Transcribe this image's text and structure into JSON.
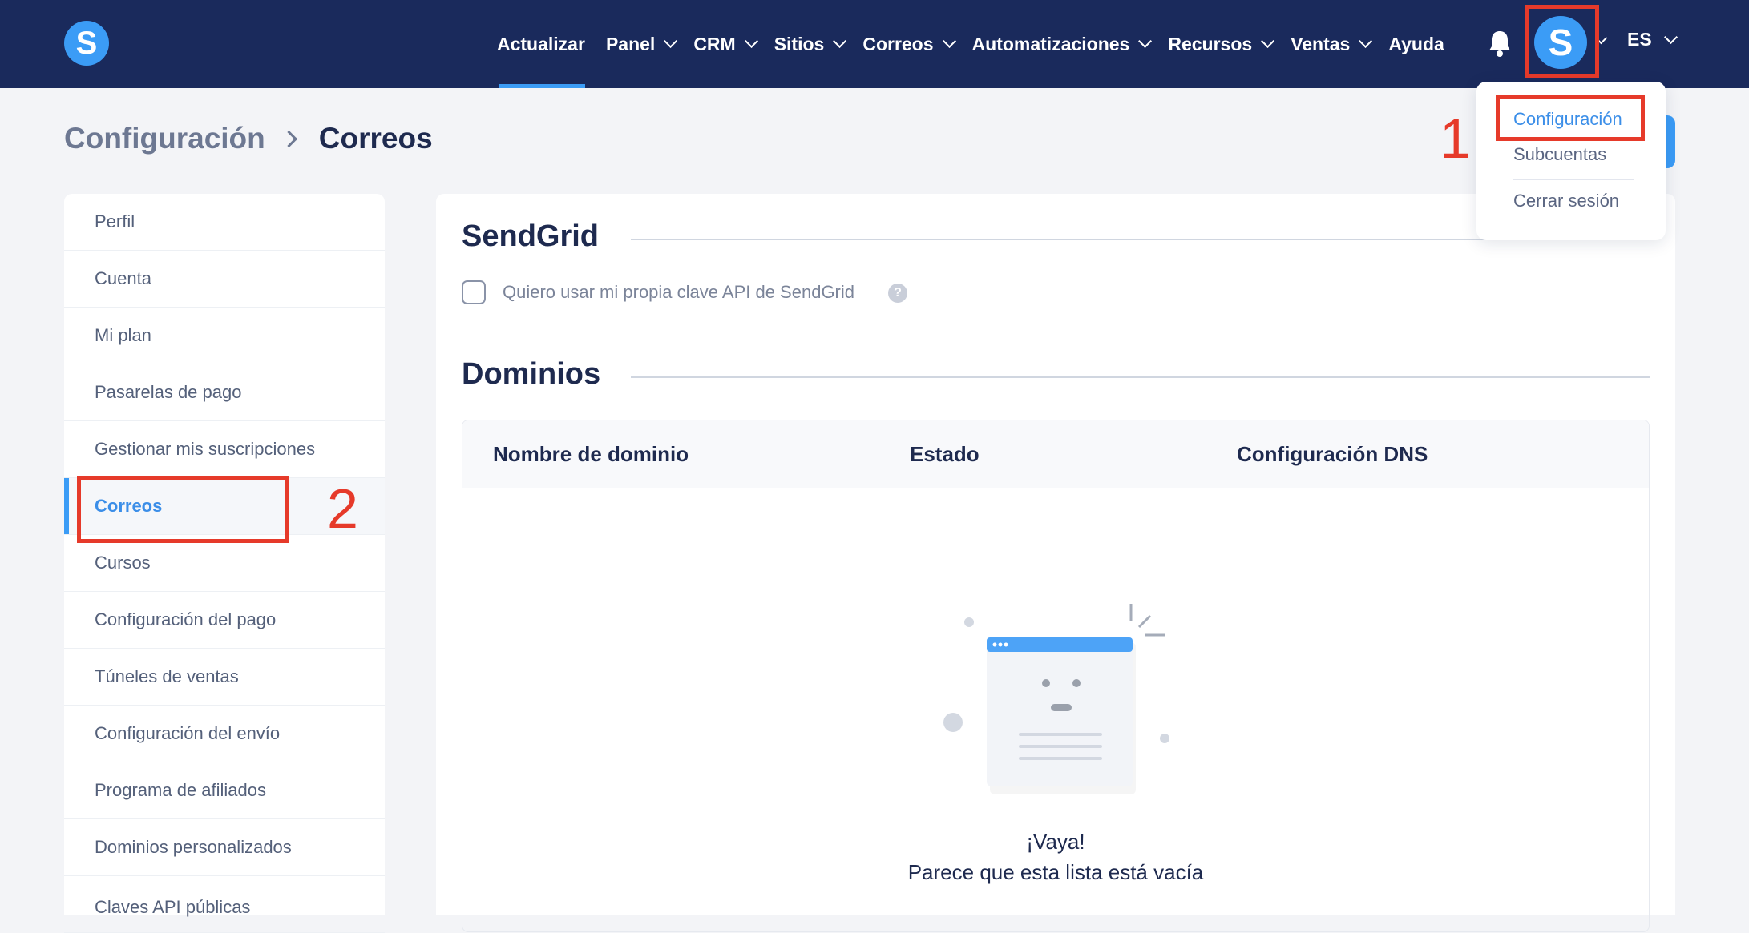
{
  "app": {
    "logo_letter": "S"
  },
  "nav": {
    "items": [
      {
        "label": "Actualizar",
        "has_dropdown": false,
        "active": true
      },
      {
        "label": "Panel",
        "has_dropdown": true
      },
      {
        "label": "CRM",
        "has_dropdown": true
      },
      {
        "label": "Sitios",
        "has_dropdown": true
      },
      {
        "label": "Correos",
        "has_dropdown": true
      },
      {
        "label": "Automatizaciones",
        "has_dropdown": true
      },
      {
        "label": "Recursos",
        "has_dropdown": true
      },
      {
        "label": "Ventas",
        "has_dropdown": true
      },
      {
        "label": "Ayuda",
        "has_dropdown": false
      }
    ],
    "avatar_letter": "S",
    "language": "ES"
  },
  "user_menu": {
    "items": [
      {
        "label": "Configuración",
        "active": true
      },
      {
        "label": "Subcuentas"
      },
      {
        "label": "Cerrar sesión"
      }
    ]
  },
  "annotations": {
    "step1": "1",
    "step2": "2"
  },
  "breadcrumb": {
    "parent": "Configuración",
    "current": "Correos"
  },
  "sidebar": {
    "items": [
      {
        "label": "Perfil"
      },
      {
        "label": "Cuenta"
      },
      {
        "label": "Mi plan"
      },
      {
        "label": "Pasarelas de pago"
      },
      {
        "label": "Gestionar mis suscripciones"
      },
      {
        "label": "Correos",
        "active": true
      },
      {
        "label": "Cursos"
      },
      {
        "label": "Configuración del pago"
      },
      {
        "label": "Túneles de ventas"
      },
      {
        "label": "Configuración del envío"
      },
      {
        "label": "Programa de afiliados"
      },
      {
        "label": "Dominios personalizados"
      },
      {
        "label": "Claves API públicas"
      }
    ]
  },
  "sendgrid": {
    "title": "SendGrid",
    "checkbox_label": "Quiero usar mi propia clave API de SendGrid",
    "help_icon": "?"
  },
  "domains": {
    "title": "Dominios",
    "columns": [
      "Nombre de dominio",
      "Estado",
      "Configuración DNS"
    ],
    "empty_title": "¡Vaya!",
    "empty_message": "Parece que esta lista está vacía"
  },
  "colors": {
    "topbar": "#1a2a5c",
    "accent": "#3b9cf6",
    "highlight": "#e63a2a"
  }
}
